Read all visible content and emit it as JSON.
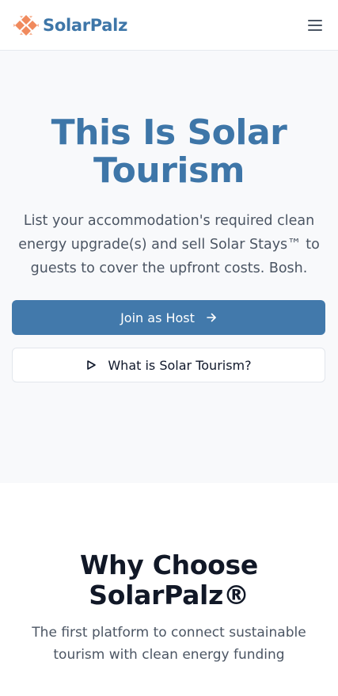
{
  "header": {
    "brand_name": "SolarPalz",
    "logo_icon": "solarpalz-logo-icon",
    "menu_icon": "hamburger-menu-icon"
  },
  "hero": {
    "title": "This Is Solar Tourism",
    "subtitle": "List your accommodation's required clean energy upgrade(s) and sell Solar Stays™ to guests to cover the upfront costs. Bosh.",
    "primary_button": {
      "label": "Join as Host",
      "icon": "arrow-right-icon"
    },
    "secondary_button": {
      "label": "What is Solar Tourism?",
      "icon": "play-icon"
    }
  },
  "why": {
    "title": "Why Choose SolarPalz®",
    "subtitle": "The first platform to connect sustainable tourism with clean energy funding"
  },
  "colors": {
    "brand_blue": "#3e76a8",
    "button_blue": "#4279ab",
    "logo_orange": "#f08a5d",
    "hero_bg": "#f8f9fb"
  }
}
